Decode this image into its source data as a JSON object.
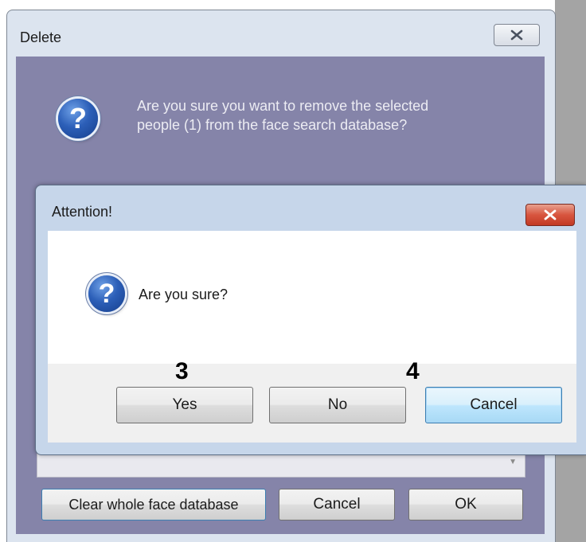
{
  "delete_dialog": {
    "title": "Delete",
    "message": "Are you sure you want to remove the selected\npeople (1) from the face search database?",
    "buttons": {
      "clear_whole": "Clear whole face database",
      "cancel": "Cancel",
      "ok": "OK"
    },
    "icons": {
      "question": "question-icon",
      "close": "close-icon"
    }
  },
  "attention_dialog": {
    "title": "Attention!",
    "message": "Are you sure?",
    "buttons": {
      "yes": "Yes",
      "no": "No",
      "cancel": "Cancel"
    },
    "icons": {
      "question": "question-icon",
      "close": "close-icon"
    }
  },
  "annotations": {
    "step_3": "3",
    "step_4": "4"
  },
  "colors": {
    "delete_client_bg": "#8584a9",
    "attention_close_red": "#c23a24",
    "focused_button_border": "#3c7fb1"
  }
}
